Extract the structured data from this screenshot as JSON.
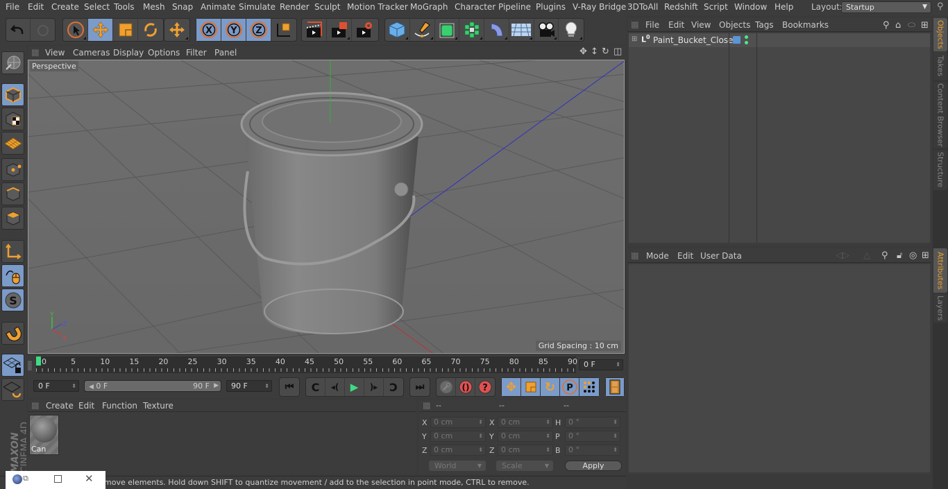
{
  "menubar": {
    "items": [
      "File",
      "Edit",
      "Create",
      "Select",
      "Tools",
      "Mesh",
      "Snap",
      "Animate",
      "Simulate",
      "Render",
      "Sculpt",
      "Motion Tracker",
      "MoGraph",
      "Character",
      "Pipeline",
      "Plugins",
      "V-Ray Bridge",
      "3DToAll",
      "Redshift",
      "Script",
      "Window",
      "Help"
    ],
    "layout_label": "Layout:",
    "layout_value": "Startup"
  },
  "toolbar": {
    "groups": [
      [
        "undo-icon",
        "redo-icon"
      ],
      [
        "live-selection-icon",
        "move-icon",
        "scale-icon",
        "rotate-icon"
      ],
      [
        "multi-move-icon"
      ],
      [
        "x-axis-icon",
        "y-axis-icon",
        "z-axis-icon",
        "coordinate-system-icon"
      ],
      [
        "render-view-icon",
        "render-picture-viewer-icon",
        "render-settings-icon"
      ],
      [
        "cube-icon",
        "pen-spline-icon",
        "subdivision-icon",
        "cloner-icon",
        "bend-deformer-icon",
        "floor-icon",
        "camera-icon",
        "light-icon"
      ]
    ]
  },
  "left_tools": [
    "make-editable-icon",
    "model-mode-icon",
    "texture-mode-icon",
    "workplane-mode-icon",
    "points-mode-icon",
    "edges-mode-icon",
    "polygons-mode-icon",
    "axis-mode-icon",
    "tweak-mode-icon",
    "solo-icon",
    "snap-icon",
    "workplane-lock-icon",
    "workplane-align-icon"
  ],
  "viewport": {
    "menu": [
      "View",
      "Cameras",
      "Display",
      "Options",
      "Filter",
      "Panel"
    ],
    "label": "Perspective",
    "grid_spacing": "Grid Spacing : 10 cm",
    "axis_labels": {
      "x": "X",
      "y": "Y",
      "z": "Z"
    }
  },
  "timeline": {
    "ticks": [
      "0",
      "5",
      "10",
      "15",
      "20",
      "25",
      "30",
      "35",
      "40",
      "45",
      "50",
      "55",
      "60",
      "65",
      "70",
      "75",
      "80",
      "85",
      "90"
    ],
    "current_frame": "0 F",
    "start_field": "0 F",
    "range_start": "0 F",
    "range_end": "90 F",
    "end_field": "90 F"
  },
  "material_panel": {
    "menu": [
      "Create",
      "Edit",
      "Function",
      "Texture"
    ],
    "materials": [
      {
        "name": "Can"
      }
    ]
  },
  "coord_panel": {
    "headers": [
      "--",
      "--",
      "--"
    ],
    "rows": [
      {
        "l1": "X",
        "v1": "0 cm",
        "l2": "X",
        "v2": "0 cm",
        "l3": "H",
        "v3": "0 °"
      },
      {
        "l1": "Y",
        "v1": "0 cm",
        "l2": "Y",
        "v2": "0 cm",
        "l3": "P",
        "v3": "0 °"
      },
      {
        "l1": "Z",
        "v1": "0 cm",
        "l2": "Z",
        "v2": "0 cm",
        "l3": "B",
        "v3": "0 °"
      }
    ],
    "mode_dropdown": "World",
    "size_dropdown": "Scale",
    "apply_label": "Apply"
  },
  "object_manager": {
    "menu": [
      "File",
      "Edit",
      "View",
      "Objects",
      "Tags",
      "Bookmarks"
    ],
    "objects": [
      {
        "name": "Paint_Bucket_Closed",
        "layer_color": "#5b95d6",
        "dots_color": "#4de88a"
      }
    ]
  },
  "attributes": {
    "menu": [
      "Mode",
      "Edit",
      "User Data"
    ]
  },
  "side_tabs_top": [
    "Objects",
    "Takes",
    "Content Browser",
    "Structure"
  ],
  "side_tabs_bottom": [
    "Attributes",
    "Layers"
  ],
  "status": {
    "text": "move elements. Hold down SHIFT to quantize movement / add to the selection in point mode, CTRL to remove."
  },
  "brand": {
    "maxon": "MAXON",
    "product": "CINEMA 4D"
  },
  "colors": {
    "accent": "#7b9bc9",
    "orange": "#f0a030",
    "active_tab": "#e8a030",
    "playhead": "#3ddc84"
  }
}
